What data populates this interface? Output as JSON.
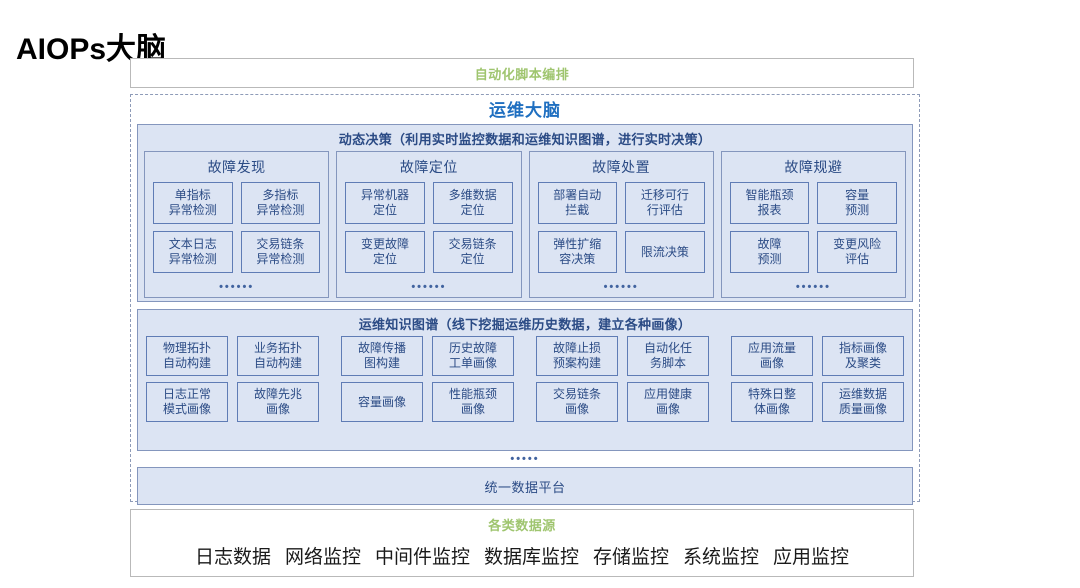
{
  "page": {
    "title": "AIOPs大脑"
  },
  "automation_band": {
    "label": "自动化脚本编排"
  },
  "brain": {
    "title": "运维大脑",
    "decision": {
      "header": "动态决策（利用实时监控数据和运维知识图谱，进行实时决策）",
      "dots": "••••••",
      "columns": [
        {
          "title": "故障发现",
          "cells": [
            "单指标\n异常检测",
            "多指标\n异常检测",
            "文本日志\n异常检测",
            "交易链条\n异常检测"
          ]
        },
        {
          "title": "故障定位",
          "cells": [
            "异常机器\n定位",
            "多维数据\n定位",
            "变更故障\n定位",
            "交易链条\n定位"
          ]
        },
        {
          "title": "故障处置",
          "cells": [
            "部署自动\n拦截",
            "迁移可行\n行评估",
            "弹性扩缩\n容决策",
            "限流决策"
          ]
        },
        {
          "title": "故障规避",
          "cells": [
            "智能瓶颈\n报表",
            "容量\n预测",
            "故障\n预测",
            "变更风险\n评估"
          ]
        }
      ]
    },
    "knowledge_graph": {
      "header": "运维知识图谱（线下挖掘运维历史数据，建立各种画像）",
      "row1": [
        [
          "物理拓扑\n自动构建",
          "业务拓扑\n自动构建"
        ],
        [
          "故障传播\n图构建",
          "历史故障\n工单画像"
        ],
        [
          "故障止损\n预案构建",
          "自动化任\n务脚本"
        ],
        [
          "应用流量\n画像",
          "指标画像\n及聚类"
        ]
      ],
      "row2": [
        [
          "日志正常\n模式画像",
          "故障先兆\n画像"
        ],
        [
          "容量画像",
          "性能瓶颈\n画像"
        ],
        [
          "交易链条\n画像",
          "应用健康\n画像"
        ],
        [
          "特殊日整\n体画像",
          "运维数据\n质量画像"
        ]
      ]
    },
    "mid_dots": "•••••",
    "platform": {
      "label": "统一数据平台"
    }
  },
  "datasource": {
    "title": "各类数据源",
    "items": [
      "日志数据",
      "网络监控",
      "中间件监控",
      "数据库监控",
      "存储监控",
      "系统监控",
      "应用监控"
    ]
  },
  "colors": {
    "accent_blue": "#1f6fc0",
    "panel_fill": "#dce4f3",
    "panel_border": "#8496bd",
    "cell_border": "#5f7cb5",
    "text_blue": "#2b4b85",
    "green": "#9fc56f",
    "dashed_border": "#8e9bb8",
    "outer_border": "#b9b9b9"
  }
}
